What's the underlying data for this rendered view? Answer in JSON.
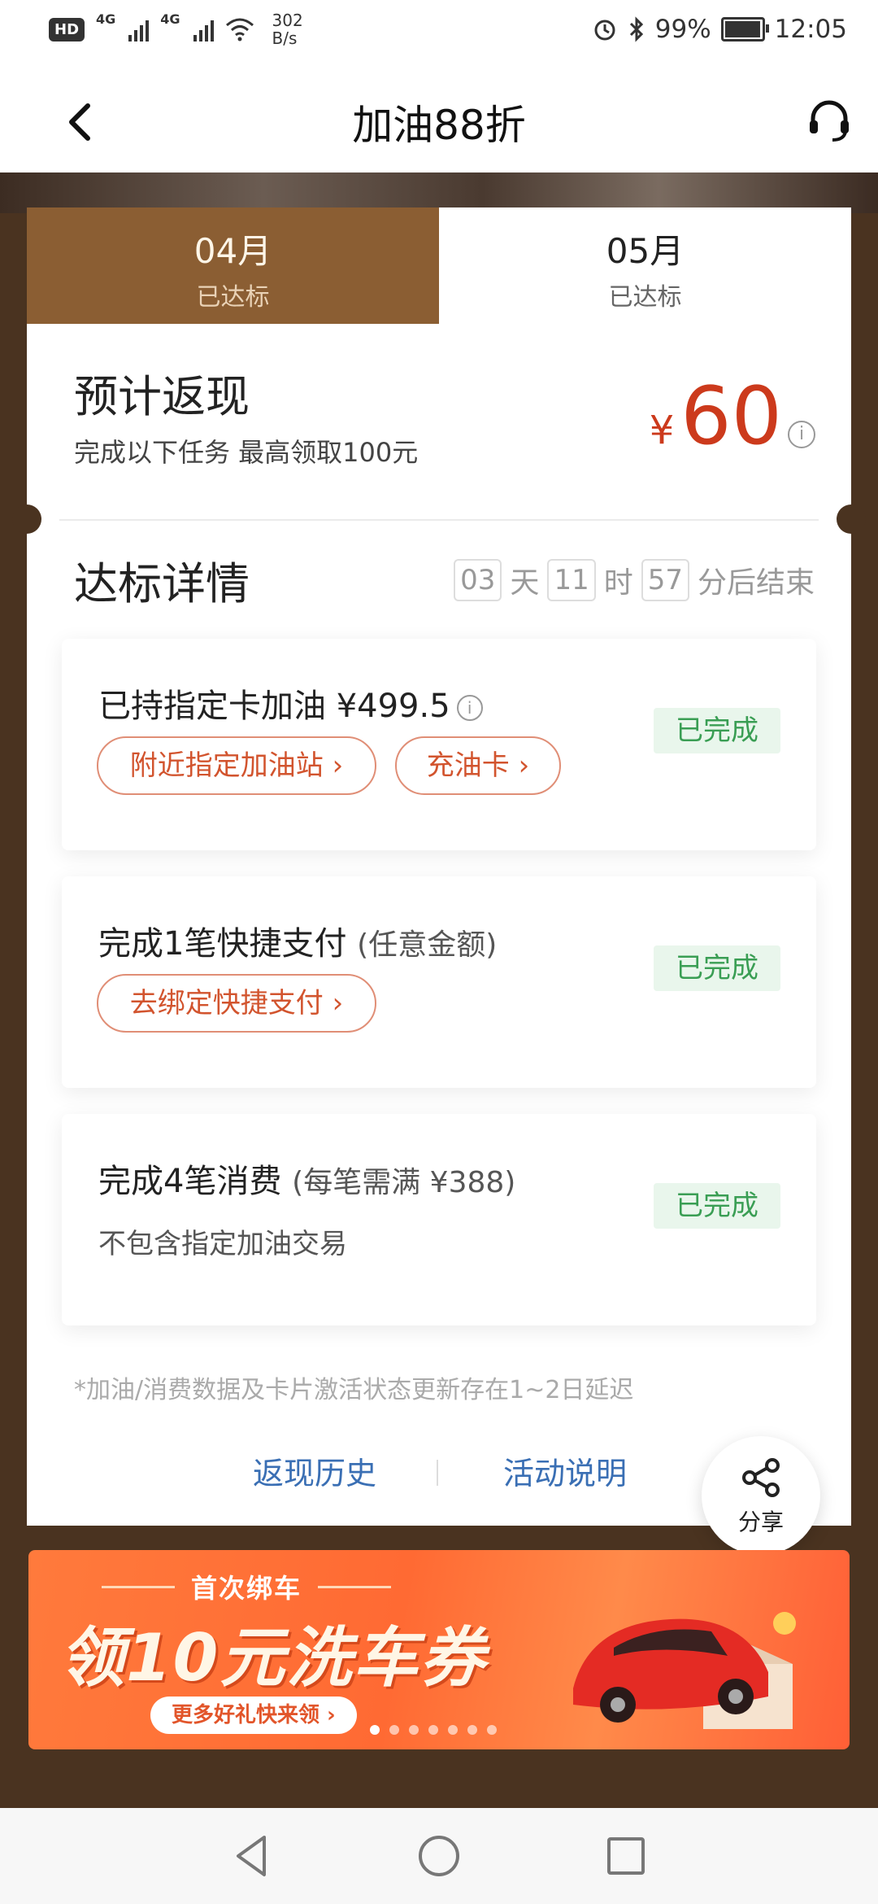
{
  "status_bar": {
    "hd_label": "HD",
    "net_label_1": "4G",
    "net_label_2": "4G",
    "speed_value": "302",
    "speed_unit": "B/s",
    "battery": "99%",
    "time": "12:05"
  },
  "header": {
    "title": "加油88折",
    "back_icon": "chevron-left-icon",
    "service_icon": "headset-icon"
  },
  "tabs": [
    {
      "month": "04月",
      "status": "已达标",
      "active": true
    },
    {
      "month": "05月",
      "status": "已达标",
      "active": false
    }
  ],
  "cashback": {
    "title": "预计返现",
    "subtitle": "完成以下任务 最高领取100元",
    "currency": "¥",
    "amount": "60",
    "info_icon": "i"
  },
  "details": {
    "title": "达标详情",
    "countdown": {
      "days": "03",
      "days_unit": "天",
      "hours": "11",
      "hours_unit": "时",
      "minutes": "57",
      "suffix": "分后结束"
    }
  },
  "tasks": [
    {
      "title": "已持指定卡加油 ¥499.5",
      "info_icon": "i",
      "status": "已完成",
      "chips": [
        "附近指定加油站 ›",
        "充油卡 ›"
      ]
    },
    {
      "title": "完成1笔快捷支付",
      "note": "(任意金额)",
      "status": "已完成",
      "chips": [
        "去绑定快捷支付 ›"
      ]
    },
    {
      "title": "完成4笔消费",
      "note": "(每笔需满 ¥388)",
      "subtitle": "不包含指定加油交易",
      "status": "已完成"
    }
  ],
  "footnote": "*加油/消费数据及卡片激活状态更新存在1~2日延迟",
  "links": {
    "history": "返现历史",
    "rules": "活动说明"
  },
  "share": {
    "label": "分享",
    "icon": "share-icon"
  },
  "banner": {
    "subtitle": "首次绑车",
    "title": "领10元洗车券",
    "button": "更多好礼快来领 ›",
    "dots_total": 7,
    "dots_active": 0
  },
  "nav": {
    "back": "triangle-back-icon",
    "home": "circle-home-icon",
    "recents": "square-recents-icon"
  },
  "colors": {
    "brand_brown": "#8b5e33",
    "amount_red": "#cc3a1c",
    "done_green": "#3a9e54",
    "link_blue": "#3a6fb4",
    "chip_orange": "#d2542e"
  }
}
